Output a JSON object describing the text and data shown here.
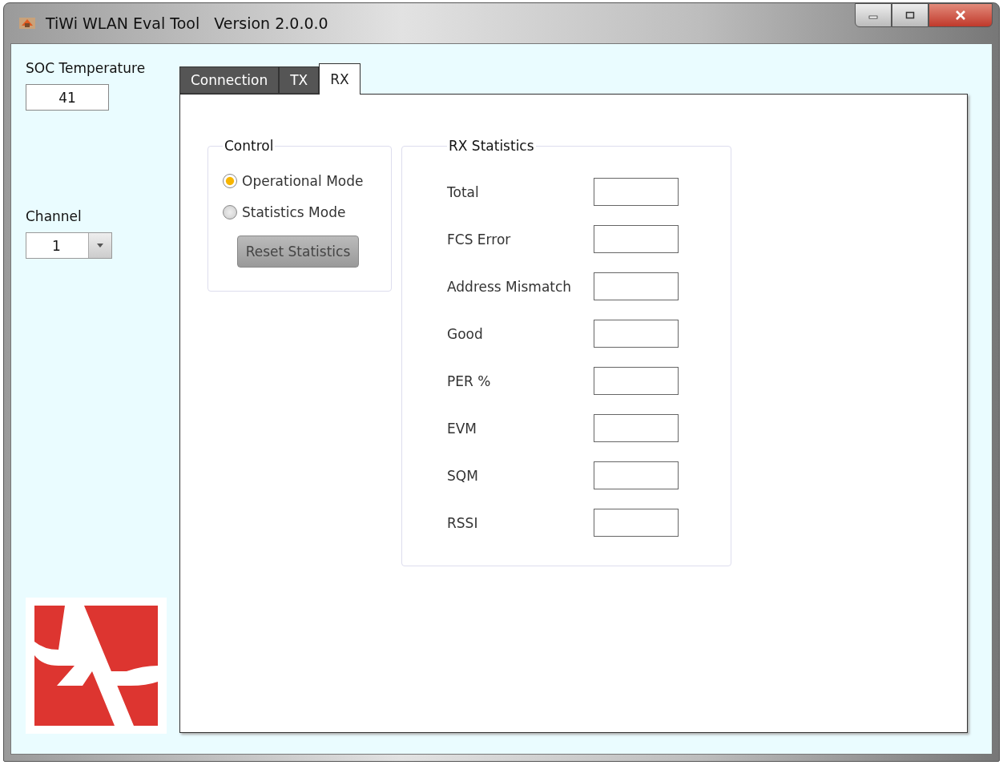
{
  "window": {
    "title": "TiWi WLAN Eval Tool   Version 2.0.0.0"
  },
  "sidebar": {
    "temperature": {
      "label": "SOC Temperature",
      "value": "41"
    },
    "channel": {
      "label": "Channel",
      "value": "1"
    }
  },
  "tabs": [
    {
      "label": "Connection",
      "selected": false
    },
    {
      "label": "TX",
      "selected": false
    },
    {
      "label": "RX",
      "selected": true
    }
  ],
  "control": {
    "title": "Control",
    "modes": [
      {
        "label": "Operational Mode",
        "selected": true
      },
      {
        "label": "Statistics Mode",
        "selected": false
      }
    ],
    "reset_button": {
      "label": "Reset Statistics",
      "disabled": true
    }
  },
  "rx_statistics": {
    "title": "RX Statistics",
    "rows": [
      {
        "label": "Total"
      },
      {
        "label": "FCS Error"
      },
      {
        "label": "Address Mismatch"
      },
      {
        "label": "Good"
      },
      {
        "label": "PER %"
      },
      {
        "label": "EVM"
      },
      {
        "label": "SQM"
      },
      {
        "label": "RSSI"
      }
    ]
  }
}
